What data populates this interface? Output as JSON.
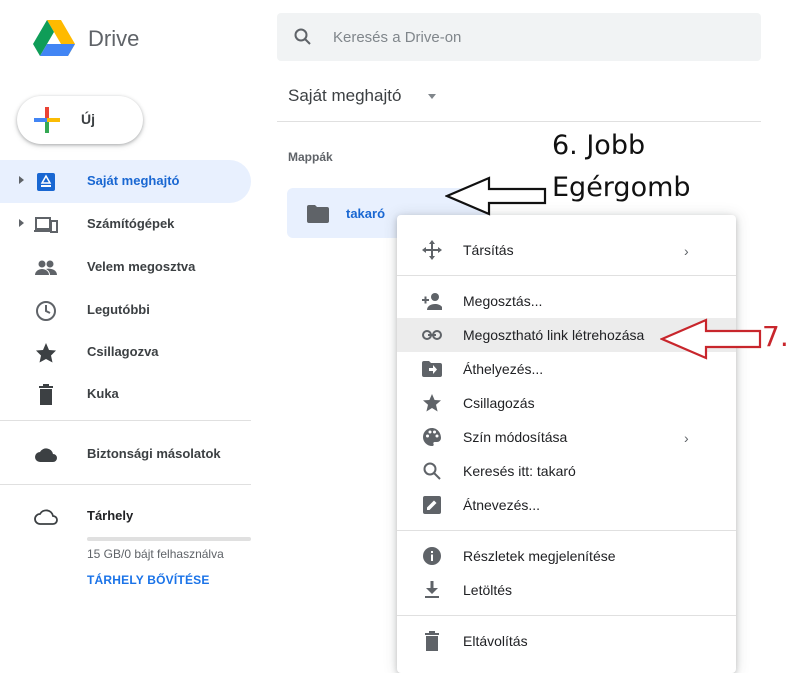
{
  "app": {
    "name": "Drive"
  },
  "search": {
    "placeholder": "Keresés a Drive-on"
  },
  "header": {
    "title": "Saját meghajtó"
  },
  "new_button": {
    "label": "Új"
  },
  "sidebar": {
    "items": [
      {
        "label": "Saját meghajtó",
        "icon": "drive-icon",
        "active": true
      },
      {
        "label": "Számítógépek",
        "icon": "computer-icon"
      },
      {
        "label": "Velem megosztva",
        "icon": "people-icon"
      },
      {
        "label": "Legutóbbi",
        "icon": "clock-icon"
      },
      {
        "label": "Csillagozva",
        "icon": "star-icon"
      },
      {
        "label": "Kuka",
        "icon": "trash-icon"
      },
      {
        "label": "Biztonsági másolatok",
        "icon": "cloud-icon"
      },
      {
        "label": "Tárhely",
        "icon": "cloud-outline-icon"
      }
    ],
    "storage": {
      "used_text": "15 GB/0 bájt felhasználva",
      "upgrade_label": "TÁRHELY BŐVÍTÉSE"
    }
  },
  "main": {
    "section_label": "Mappák",
    "folders": [
      {
        "name": "takaró"
      }
    ]
  },
  "context_menu": {
    "items": [
      {
        "label": "Társítás",
        "icon": "move-arrows-icon",
        "submenu": "›"
      },
      {
        "label": "Megosztás...",
        "icon": "add-person-icon"
      },
      {
        "label": "Megosztható link létrehozása",
        "icon": "link-icon",
        "highlighted": true
      },
      {
        "label": "Áthelyezés...",
        "icon": "folder-move-icon"
      },
      {
        "label": "Csillagozás",
        "icon": "star-icon"
      },
      {
        "label": "Szín módosítása",
        "icon": "palette-icon",
        "submenu": "›"
      },
      {
        "label": "Keresés itt: takaró",
        "icon": "search-icon"
      },
      {
        "label": "Átnevezés...",
        "icon": "edit-icon"
      },
      {
        "label": "Részletek megjelenítése",
        "icon": "info-icon"
      },
      {
        "label": "Letöltés",
        "icon": "download-icon"
      },
      {
        "label": "Eltávolítás",
        "icon": "trash-icon"
      }
    ]
  },
  "annotations": {
    "step6_line1": "6. Jobb",
    "step6_line2": "Egérgomb",
    "step7": "7."
  },
  "colors": {
    "accent": "#1967d2",
    "active_bg": "#e8f0fe",
    "annotation_red": "#c8262c"
  }
}
